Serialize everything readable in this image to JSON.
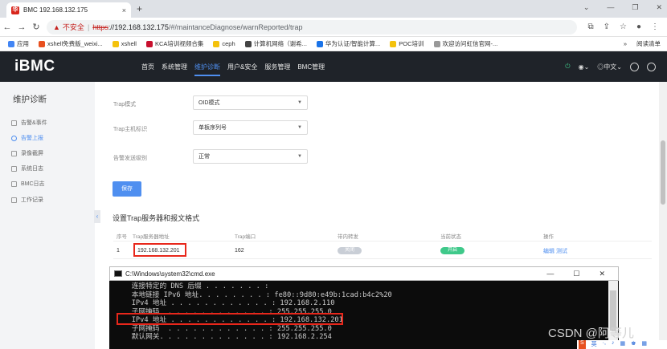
{
  "browser": {
    "tab_title": "BMC 192.168.132.175",
    "tab_close": "×",
    "new_tab": "+",
    "favicon_text": "华",
    "address": {
      "insecure": "不安全",
      "scheme": "https",
      "host": "://192.168.132.175",
      "path": "/#/maintanceDiagnose/warnReported/trap"
    },
    "bookmarks": [
      {
        "label": "应用",
        "color": "#4285f4"
      },
      {
        "label": "xshell免费版_weixi...",
        "color": "#e8501f"
      },
      {
        "label": "xshell",
        "color": "#f4c20d"
      },
      {
        "label": "KCA培训视频合集",
        "color": "#c8102e"
      },
      {
        "label": "ceph",
        "color": "#f4c20d"
      },
      {
        "label": "计算机网络（谢希...",
        "color": "#444444"
      },
      {
        "label": "华为认证/智能计算...",
        "color": "#1a73e8"
      },
      {
        "label": "POC培训",
        "color": "#f4c20d"
      },
      {
        "label": "欢迎访问虹信官网-...",
        "color": "#999999"
      }
    ],
    "bookmarks_more": "»",
    "reading_list": "阅读清单"
  },
  "header": {
    "logo": "iBMC",
    "nav": [
      "首页",
      "系统管理",
      "维护诊断",
      "用户&安全",
      "服务管理",
      "BMC管理"
    ],
    "active_nav": 2,
    "language": "中文"
  },
  "sidebar": {
    "title": "维护诊断",
    "items": [
      "告警&事件",
      "告警上报",
      "录像截屏",
      "系统日志",
      "BMC日志",
      "工作记录"
    ],
    "active": 1,
    "collapse": "‹"
  },
  "form": {
    "trap_mode_label": "Trap模式",
    "trap_mode_value": "OID模式",
    "trap_host_label": "Trap主机标识",
    "trap_host_value": "单板序列号",
    "alarm_level_label": "告警发送级别",
    "alarm_level_value": "正常",
    "save": "保存"
  },
  "section_title": "设置Trap服务器和报文格式",
  "table": {
    "headers": [
      "序号",
      "Trap服务器地址",
      "Trap端口",
      "带内转发",
      "当前状态",
      "操作"
    ],
    "rows": [
      {
        "index": "1",
        "address": "192.168.132.201",
        "port": "162",
        "inband": "关闭",
        "status": "开启",
        "edit": "编辑",
        "test": "测试"
      }
    ]
  },
  "cmd": {
    "title": "C:\\Windows\\system32\\cmd.exe",
    "lines": [
      "   连接特定的 DNS 后缀 . . . . . . . :",
      "   本地链接 IPv6 地址. . . . . . . . : fe80::9d80:e49b:1cad:b4c2%20",
      "   IPv4 地址 . . . . . . . . . . . . : 192.168.2.110",
      "   子网掩码  . . . . . . . . . . . . : 255.255.255.0",
      "   IPv4 地址 . . . . . . . . . . . . : 192.168.132.201",
      "   子网掩码  . . . . . . . . . . . . : 255.255.255.0",
      "   默认网关. . . . . . . . . . . . . : 192.168.2.254"
    ]
  },
  "watermark": "CSDN @阿等儿",
  "ime": [
    "S",
    "英",
    "·,",
    "♪",
    "▦",
    "♚",
    "▦"
  ]
}
